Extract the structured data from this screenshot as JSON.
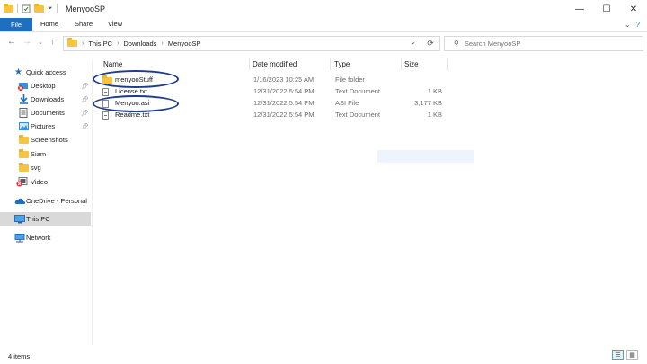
{
  "window": {
    "title": "MenyooSP",
    "controls": [
      "—",
      "☐",
      "✕"
    ]
  },
  "ribbon": {
    "tabs": [
      "File",
      "Home",
      "Share",
      "View"
    ],
    "help_glyph": "?"
  },
  "address": {
    "crumbs": [
      "This PC",
      "Downloads",
      "MenyooSP"
    ]
  },
  "search": {
    "placeholder": "Search MenyooSP"
  },
  "sidebar": {
    "items": [
      {
        "label": "Quick access",
        "icon": "star-icon"
      },
      {
        "label": "Desktop",
        "icon": "desktop-icon",
        "pinned": true
      },
      {
        "label": "Downloads",
        "icon": "download-icon",
        "pinned": true
      },
      {
        "label": "Documents",
        "icon": "documents-icon",
        "pinned": true
      },
      {
        "label": "Pictures",
        "icon": "pictures-icon",
        "pinned": true
      },
      {
        "label": "Screenshots",
        "icon": "folder-icon"
      },
      {
        "label": "Siam",
        "icon": "folder-icon"
      },
      {
        "label": "svg",
        "icon": "folder-icon"
      },
      {
        "label": "Video",
        "icon": "video-icon"
      },
      {
        "label": "OneDrive - Personal",
        "icon": "cloud-icon"
      },
      {
        "label": "This PC",
        "icon": "computer-icon",
        "selected": true
      },
      {
        "label": "Network",
        "icon": "network-icon"
      }
    ]
  },
  "columns": [
    "Name",
    "Date modified",
    "Type",
    "Size"
  ],
  "files": [
    {
      "name": "menyooStuff",
      "date": "1/16/2023 10:25 AM",
      "type": "File folder",
      "size": "",
      "icon": "folder-icon"
    },
    {
      "name": "License.txt",
      "date": "12/31/2022 5:54 PM",
      "type": "Text Document",
      "size": "1 KB",
      "icon": "text-file-icon"
    },
    {
      "name": "Menyoo.asi",
      "date": "12/31/2022 5:54 PM",
      "type": "ASI File",
      "size": "3,177 KB",
      "icon": "file-icon"
    },
    {
      "name": "Readme.txt",
      "date": "12/31/2022 5:54 PM",
      "type": "Text Document",
      "size": "1 KB",
      "icon": "text-file-icon"
    }
  ],
  "status": {
    "item_count": "4 items"
  },
  "colors": {
    "accent": "#1e6fc0",
    "highlight_ellipse": "#1f3d8a",
    "selected_bg": "#d9d9d9",
    "folder": "#f5c542"
  }
}
